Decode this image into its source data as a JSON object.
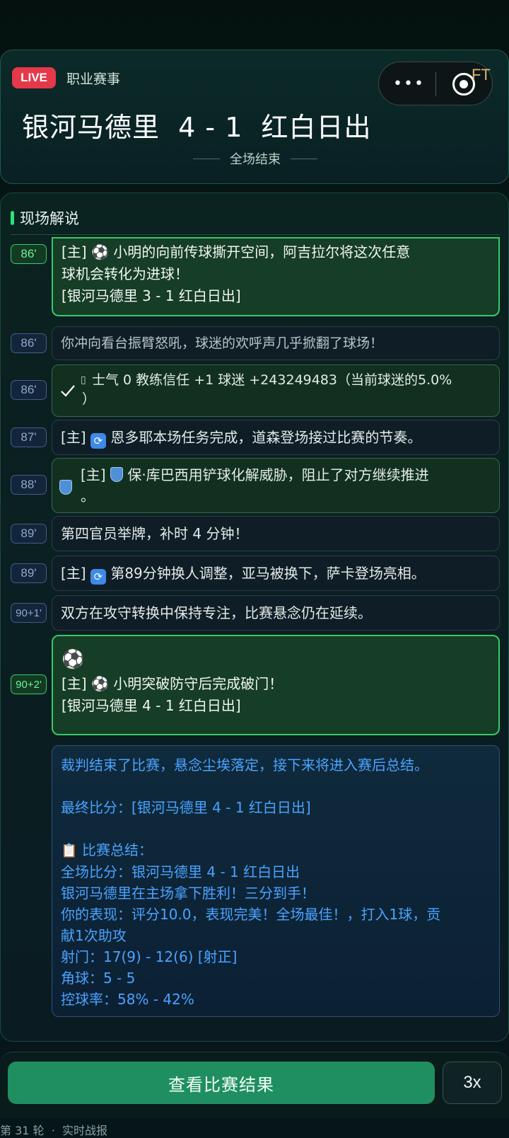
{
  "header": {
    "live_label": "LIVE",
    "league": "职业赛事",
    "ft_label": "FT",
    "score_line": "银河马德里  4 - 1  红白日出",
    "status": "全场结束",
    "capsule_menu": "•••",
    "capsule_close_icon": "target-icon"
  },
  "commentary": {
    "title": "现场解说",
    "rows": [
      {
        "minute": "86'",
        "line1": "[主] ",
        "line1b": " 小明的向前传球撕开空间，阿吉拉尔将这次任意",
        "line2": "球机会转化为进球！",
        "line3": "[银河马德里 3 - 1 红白日出]"
      },
      {
        "minute": "86'",
        "text": "你冲向看台振臂怒吼，球迷的欢呼声几乎掀翻了球场！"
      },
      {
        "minute": "86'",
        "text_a": "  士气 0  教练信任 +1  球迷 +243249483（当前球迷的5.0%",
        "text_b": "）"
      },
      {
        "minute": "87'",
        "pre": "[主] ",
        "text": " 恩多耶本场任务完成，道森登场接过比赛的节奏。"
      },
      {
        "minute": "88'",
        "pre": "[主] ",
        "text": " 保·库巴西用铲球化解威胁，阻止了对方继续推进",
        "text_b": "。"
      },
      {
        "minute": "89'",
        "text": "第四官员举牌，补时 4 分钟！"
      },
      {
        "minute": "89'",
        "pre": "[主] ",
        "text": " 第89分钟换人调整，亚马被换下，萨卡登场亮相。"
      },
      {
        "minute": "90+1'",
        "text": "双方在攻守转换中保持专注，比赛悬念仍在延续。"
      },
      {
        "minute": "90+2'",
        "pre": "[主] ",
        "text": " 小明突破防守后完成破门！",
        "line3": "[银河马德里 4 - 1 红白日出]"
      }
    ],
    "summary": {
      "line1": "裁判结束了比赛，悬念尘埃落定，接下来将进入赛后总结。",
      "line2": "最终比分：[银河马德里 4 - 1 红白日出]",
      "line3": " 比赛总结：",
      "line4": "全场比分：银河马德里 4 - 1 红白日出",
      "line5": "银河马德里在主场拿下胜利！三分到手！",
      "line6": "你的表现：评分10.0，表现完美！全场最佳！，打入1球，贡",
      "line7": "献1次助攻",
      "line8": "射门：17(9) - 12(6) [射正]",
      "line9": "角球：5 - 5",
      "line10": "控球率：58% - 42%"
    }
  },
  "actions": {
    "view_result": "查看比赛结果",
    "speed": "3x"
  },
  "footer": {
    "text": "第 31 轮  ·  实时战报"
  },
  "colors": {
    "accent_green": "#1f8f5f",
    "live_red": "#e5384a",
    "summary_blue": "#4aa3ff"
  }
}
